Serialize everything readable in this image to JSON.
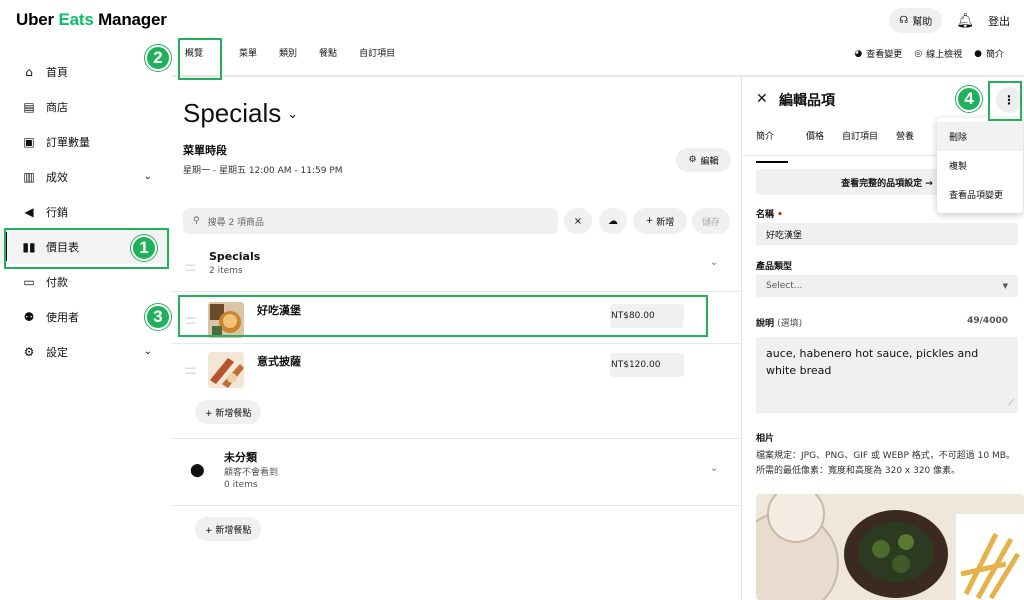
{
  "app": {
    "logo": {
      "uber": "Uber",
      "eats": "Eats",
      "manager": " Manager"
    },
    "help_label": "幫助",
    "logout_label": "登出"
  },
  "colors": {
    "brand_green": "#06c167",
    "highlight": "#21b05c"
  },
  "tabs": [
    {
      "label": "概覽",
      "active": true
    },
    {
      "label": "菜單"
    },
    {
      "label": "類別"
    },
    {
      "label": "餐點"
    },
    {
      "label": "自訂項目"
    }
  ],
  "tabs_right": [
    {
      "label": "查看變更",
      "icon": "history-icon"
    },
    {
      "label": "線上檢視",
      "icon": "preview-icon"
    },
    {
      "label": "簡介",
      "icon": "dot-icon"
    }
  ],
  "sidebar": {
    "items": [
      {
        "label": "首頁",
        "icon": "home-icon"
      },
      {
        "label": "商店",
        "icon": "store-icon"
      },
      {
        "label": "訂單數量",
        "icon": "orders-icon"
      },
      {
        "label": "成效",
        "icon": "chart-icon",
        "expandable": true
      },
      {
        "label": "行銷",
        "icon": "megaphone-icon"
      },
      {
        "label": "價目表",
        "icon": "menu-book-icon",
        "active": true
      },
      {
        "label": "付款",
        "icon": "payment-icon"
      },
      {
        "label": "使用者",
        "icon": "users-icon"
      },
      {
        "label": "設定",
        "icon": "gear-icon",
        "expandable": true
      }
    ]
  },
  "markers": [
    "1",
    "2",
    "3",
    "4"
  ],
  "main": {
    "title": "Specials",
    "hours_label": "菜單時段",
    "hours_value": "星期一 - 星期五  12:00 AM - 11:59 PM",
    "edit_label": "編輯",
    "search_placeholder": "搜尋 2 項商品",
    "add_label": "新增",
    "save_label": "儲存",
    "categories": [
      {
        "name": "Specials",
        "count": "2 items",
        "items": [
          {
            "name": "好吃漢堡",
            "price": "NT$80.00"
          },
          {
            "name": "意式披薩",
            "price": "NT$120.00"
          }
        ],
        "add_item_label": "+ 新增餐點"
      },
      {
        "name": "未分類",
        "subtitle": "顧客不會看到",
        "count": "0 items",
        "add_item_label": "+ 新增餐點"
      }
    ]
  },
  "panel": {
    "title": "編輯品項",
    "tabs": [
      "簡介",
      "價格",
      "自訂項目",
      "營養"
    ],
    "view_all_label": "查看完整的品項設定 →",
    "name_label": "名稱",
    "name_required": "•",
    "name_value": "好吃漢堡",
    "type_label": "產品類型",
    "type_value": "Select...",
    "desc_label": "說明",
    "desc_optional": "(選填)",
    "desc_counter": "49/4000",
    "desc_value": "auce, habenero hot sauce, pickles and white bread",
    "photo_label": "相片",
    "photo_help": "檔案規定：JPG、PNG、GIF 或 WEBP 格式，不可超過 10 MB。所需的最低像素：寬度和高度為 320 x 320 像素。",
    "menu": [
      "刪除",
      "複製",
      "查看品項變更"
    ]
  }
}
